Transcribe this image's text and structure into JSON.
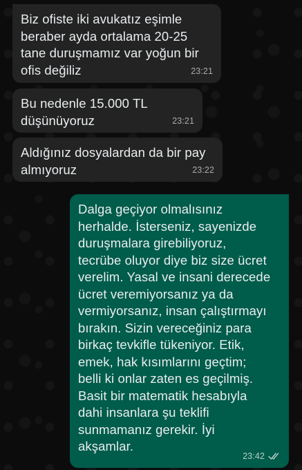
{
  "messages": [
    {
      "direction": "incoming",
      "text": "Biz ofiste iki avukatız eşimle\nberaber ayda ortalama 20-25\ntane duruşmamız var yoğun bir\nofis değiliz",
      "time": "23:21"
    },
    {
      "direction": "incoming",
      "text": "Bu nedenle 15.000 TL\ndüşünüyoruz",
      "time": "23:21"
    },
    {
      "direction": "incoming",
      "text": "Aldığınız dosyalardan da bir pay\nalmıyoruz",
      "time": "23:22"
    },
    {
      "direction": "outgoing",
      "text": "Dalga geçiyor olmalısınız\nherhalde. İsterseniz, sayenizde\nduruşmalara girebiliyoruz,\ntecrübe oluyor diye biz size ücret\nverelim. Yasal ve insani derecede\nücret veremiyorsanız ya da\nvermiyorsanız, insan çalıştırmayı\nbırakın. Sizin vereceğiniz para\nbirkaç tevkifle tükeniyor. Etik,\nemek, hak kısımlarını geçtim;\nbelli ki onlar zaten es geçilmiş.\nBasit bir matematik hesabıyla\ndahi insanlara şu teklifi\nsunmamanız gerekir. İyi\nakşamlar.",
      "time": "23:42",
      "status_icon": "double-check-icon"
    }
  ],
  "colors": {
    "incoming_bubble": "#232323",
    "outgoing_bubble": "#005c4b",
    "text": "#e9edef",
    "wallpaper": "#0c0c0c"
  }
}
